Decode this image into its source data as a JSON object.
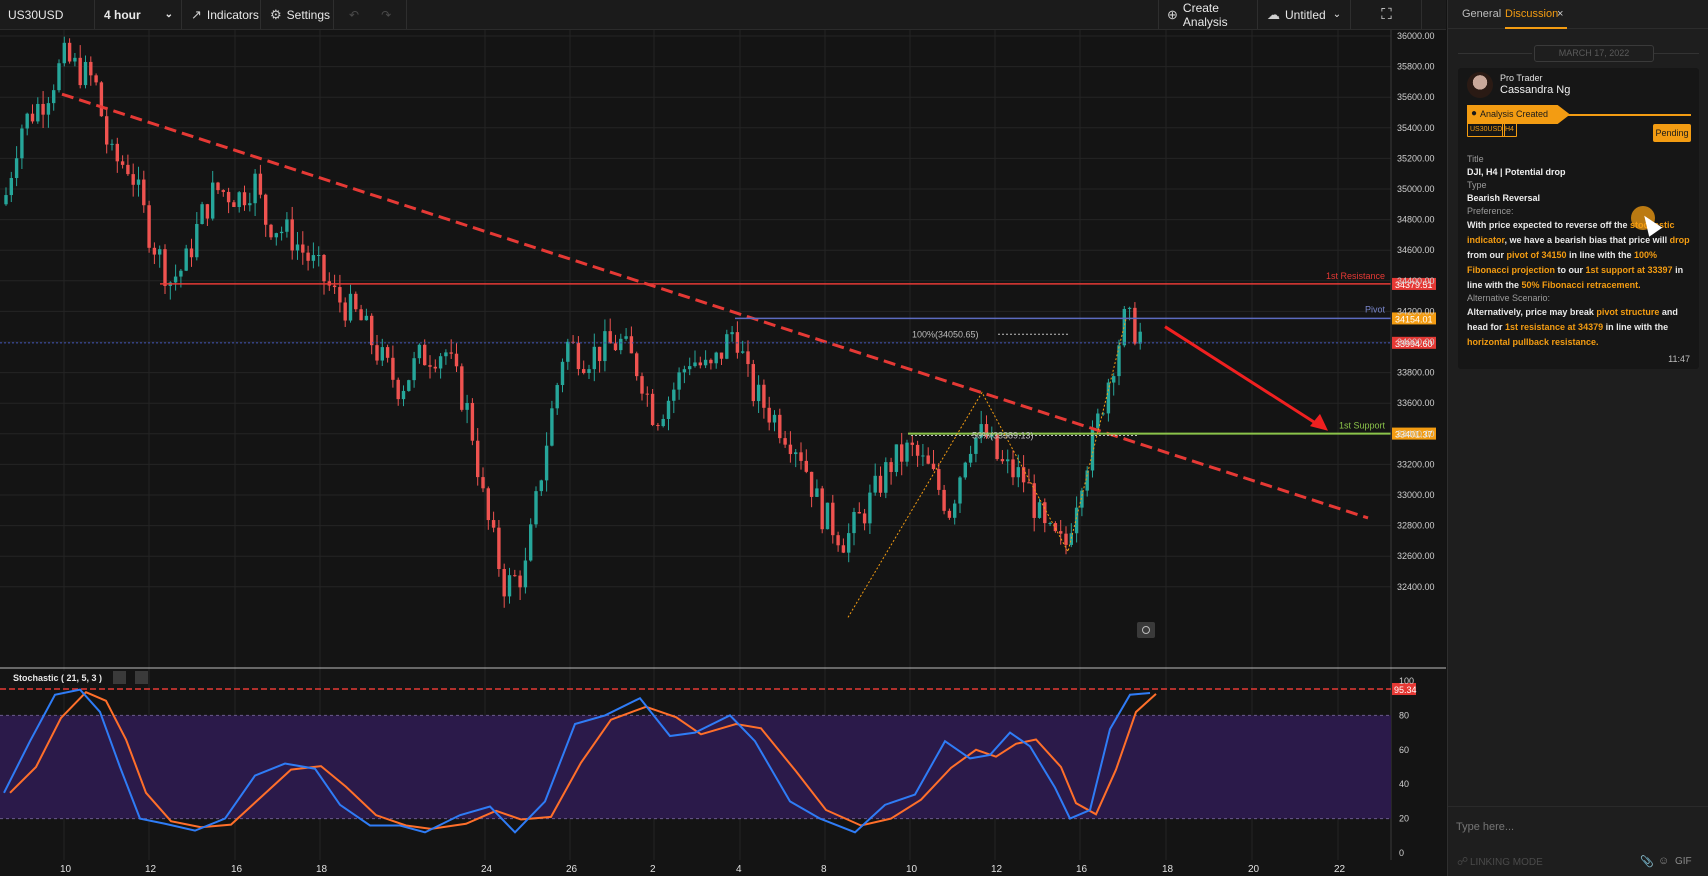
{
  "topbar": {
    "symbol": "US30USD",
    "timeframe": "4 hour",
    "indicators": "Indicators",
    "settings": "Settings",
    "create_analysis": "Create Analysis",
    "layout_name": "Untitled"
  },
  "chart": {
    "price_axis": [
      "36000.00",
      "35800.00",
      "35600.00",
      "35400.00",
      "35200.00",
      "35000.00",
      "34800.00",
      "34600.00",
      "34400.00",
      "34200.00",
      "34000.00",
      "33800.00",
      "33600.00",
      "33400.00",
      "33200.00",
      "33000.00",
      "32800.00",
      "32600.00",
      "32400.00"
    ],
    "date_axis": [
      "10",
      "12",
      "16",
      "18",
      "24",
      "26",
      "2",
      "4",
      "8",
      "10",
      "12",
      "16",
      "18",
      "20",
      "22"
    ],
    "levels": {
      "resistance_label": "1st Resistance",
      "resistance_value": "34379.51",
      "pivot_label": "Pivot",
      "pivot_value": "34154.01",
      "current_value": "33994.60",
      "support_label": "1st Support",
      "support_value": "33401.37"
    },
    "fib_100": "100%(34050.65)",
    "fib_50": "50%(33389.13)",
    "stochastic": {
      "title": "Stochastic ( 21, 5, 3 )",
      "scale": [
        "100",
        "80",
        "60",
        "40",
        "20",
        "0"
      ],
      "value": "95.34"
    },
    "colors": {
      "up": "#26a69a",
      "down": "#ef5350",
      "accent": "#f39c12"
    }
  },
  "sidebar": {
    "tabs": [
      "General",
      "Discussion"
    ],
    "close_glyph": "×",
    "date": "MARCH 17, 2022",
    "author_role": "Pro Trader",
    "author_name": "Cassandra Ng",
    "status_ribbon": "Analysis Created",
    "badges": [
      "US30USD",
      "H4"
    ],
    "status": "Pending",
    "title_label": "Title",
    "title_value": "DJI, H4 | Potential drop",
    "type_label": "Type",
    "type_value": "Bearish Reversal",
    "preference_label": "Preference:",
    "alt_label": "Alternative Scenario:",
    "time": "11:47",
    "input_placeholder": "Type here...",
    "linking_mode": "LINKING MODE",
    "gif": "GIF"
  }
}
